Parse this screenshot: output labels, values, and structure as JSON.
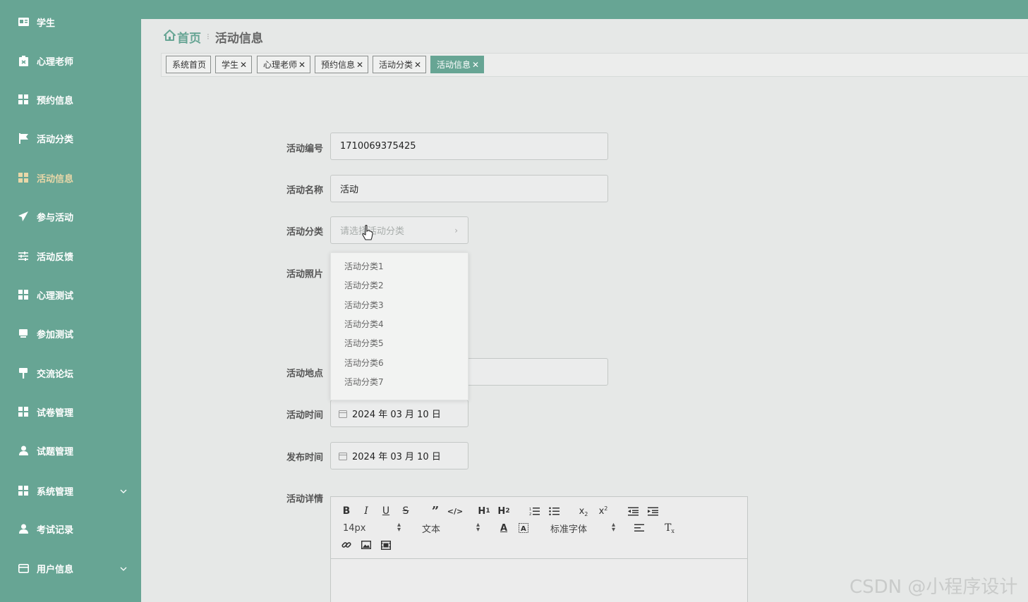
{
  "sidebar": {
    "items": [
      {
        "label": "学生",
        "icon": "id-card-icon"
      },
      {
        "label": "心理老师",
        "icon": "clipboard-icon"
      },
      {
        "label": "预约信息",
        "icon": "grid-icon"
      },
      {
        "label": "活动分类",
        "icon": "flag-icon"
      },
      {
        "label": "活动信息",
        "icon": "grid-icon"
      },
      {
        "label": "参与活动",
        "icon": "paper-plane-icon"
      },
      {
        "label": "活动反馈",
        "icon": "sliders-icon"
      },
      {
        "label": "心理测试",
        "icon": "grid-icon"
      },
      {
        "label": "参加测试",
        "icon": "monitor-icon"
      },
      {
        "label": "交流论坛",
        "icon": "signpost-icon"
      },
      {
        "label": "试卷管理",
        "icon": "grid-icon"
      },
      {
        "label": "试题管理",
        "icon": "user-icon"
      },
      {
        "label": "系统管理",
        "icon": "grid-icon"
      },
      {
        "label": "考试记录",
        "icon": "user-icon"
      },
      {
        "label": "用户信息",
        "icon": "card-icon"
      }
    ]
  },
  "breadcrumb": {
    "home": "首页",
    "separator": "⁝",
    "current": "活动信息"
  },
  "tabs": [
    {
      "label": "系统首页"
    },
    {
      "label": "学生"
    },
    {
      "label": "心理老师"
    },
    {
      "label": "预约信息"
    },
    {
      "label": "活动分类"
    },
    {
      "label": "活动信息"
    }
  ],
  "form": {
    "code": {
      "label": "活动编号",
      "value": "1710069375425"
    },
    "name": {
      "label": "活动名称",
      "value": "活动"
    },
    "category": {
      "label": "活动分类",
      "placeholder": "请选择活动分类"
    },
    "photo": {
      "label": "活动照片"
    },
    "location": {
      "label": "活动地点"
    },
    "time": {
      "label": "活动时间",
      "value": "2024 年 03 月 10 日"
    },
    "publish_time": {
      "label": "发布时间",
      "value": "2024 年 03 月 10 日"
    },
    "details": {
      "label": "活动详情"
    }
  },
  "dropdown": {
    "options": [
      "活动分类1",
      "活动分类2",
      "活动分类3",
      "活动分类4",
      "活动分类5",
      "活动分类6",
      "活动分类7"
    ]
  },
  "editor": {
    "font_size": "14px",
    "block_type": "文本",
    "font_family": "标准字体"
  },
  "watermark": "CSDN @小程序设计",
  "colors": {
    "accent": "#67a594",
    "active_sidebar_text": "#e9d7a8"
  }
}
